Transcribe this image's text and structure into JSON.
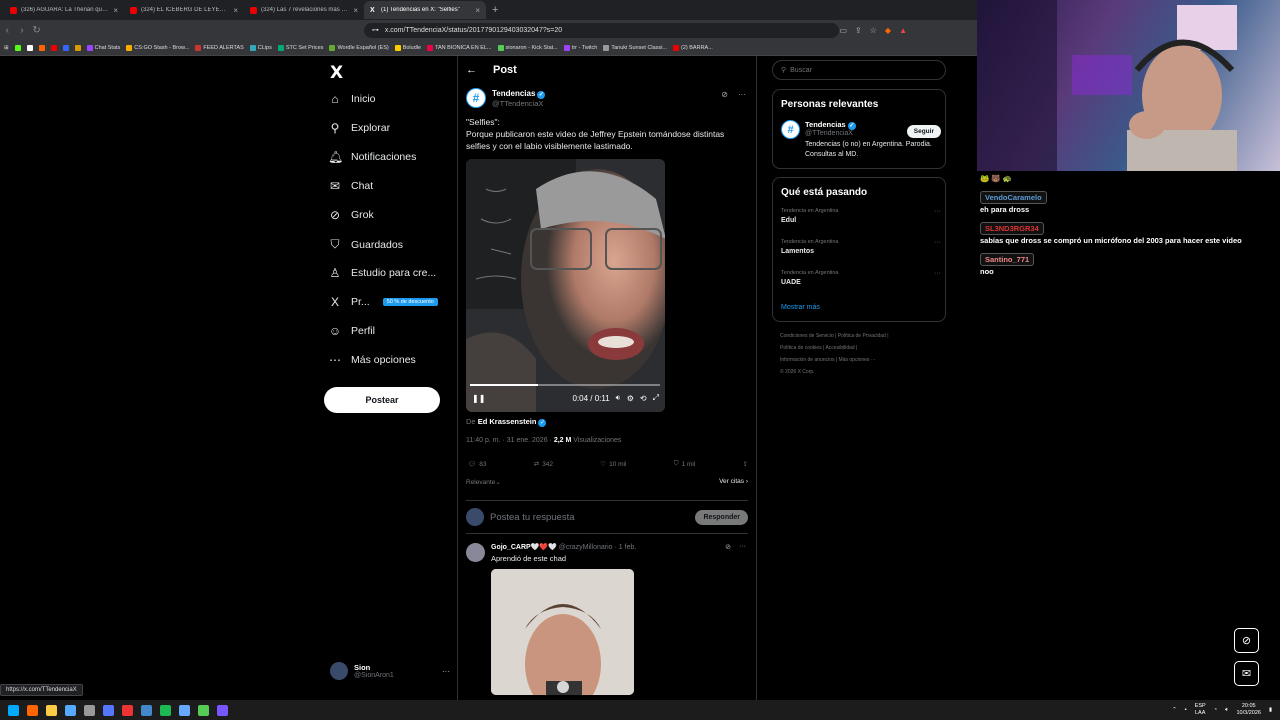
{
  "browser": {
    "tabs": [
      {
        "title": "(326) AGUARA: La Therian que Resulto",
        "icon": "youtube-icon"
      },
      {
        "title": "(324) EL ICEBERG DE LEYENDAS URBANAS",
        "icon": "youtube-icon"
      },
      {
        "title": "(324) Las 7 revelaciones más perturbadoras",
        "icon": "youtube-icon"
      },
      {
        "title": "(1) Tendencias en X: \"Selfies\"",
        "icon": "x-icon",
        "active": true
      }
    ],
    "url": "x.com/TTendenciaX/status/2017790129403032047?s=20",
    "bookmarks": [
      "Chat Stats",
      "CS:GO Stash - Brow...",
      "FEED ALERTAS",
      "CLips",
      "STC Set Prices",
      "Wordle Español (ES)",
      "Boludle",
      "TAN BIONICA EN EL...",
      "sionaron - Kick Stat...",
      "trr - Twitch",
      "Tanuki Sunset Classi...",
      "(2) BARRA..."
    ],
    "status_url": "https://x.com/TTendenciaX"
  },
  "nav": {
    "logo": "X",
    "items": [
      {
        "label": "Inicio",
        "icon": "home-icon"
      },
      {
        "label": "Explorar",
        "icon": "search-icon"
      },
      {
        "label": "Notificaciones",
        "icon": "bell-icon"
      },
      {
        "label": "Chat",
        "icon": "mail-icon"
      },
      {
        "label": "Grok",
        "icon": "grok-icon"
      },
      {
        "label": "Guardados",
        "icon": "bookmark-icon"
      },
      {
        "label": "Estudio para cre...",
        "icon": "creator-icon"
      },
      {
        "label": "Pr...",
        "icon": "premium-icon",
        "promo": "50 % de descuento"
      },
      {
        "label": "Perfil",
        "icon": "person-icon"
      },
      {
        "label": "Más opciones",
        "icon": "more-icon"
      }
    ],
    "post_button": "Postear",
    "user": {
      "name": "Sion",
      "handle": "@SionAron1"
    }
  },
  "post": {
    "header": "Post",
    "author": {
      "name": "Tendencias",
      "handle": "@TTendenciaX"
    },
    "text_line1": "\"Selfies\":",
    "text_line2": "Porque publicaron este video de Jeffrey Epstein tomándose distintas selfies y con el labio visiblemente lastimado.",
    "video": {
      "time": "0:04 / 0:11",
      "progress": 0.36
    },
    "credit_prefix": "De",
    "credit_name": "Ed Krassenstein",
    "meta_time": "11:40 p. m. · 31 ene. 2026 ·",
    "meta_views": "2,2 M",
    "meta_views_label": "Visualizaciones",
    "stats": {
      "replies": "83",
      "reposts": "342",
      "likes": "10 mil",
      "bookmarks": "1 mil"
    },
    "sort_label": "Relevante",
    "quotes_label": "Ver citas",
    "reply_placeholder": "Postea tu respuesta",
    "reply_button": "Responder"
  },
  "reply": {
    "name": "Gojo_CARP🤍❤️🤍",
    "handle": "@crazyMillonario · 1 feb.",
    "text": "Aprendió de este chad"
  },
  "sidebar": {
    "search_placeholder": "Buscar",
    "relevant_title": "Personas relevantes",
    "relevant": {
      "name": "Tendencias",
      "handle": "@TTendenciaX",
      "bio": "Tendencias (o no) en Argentina. Parodia. Consultas al MD.",
      "follow": "Seguir"
    },
    "trends_title": "Qué está pasando",
    "trends": [
      {
        "context": "Tendencia en Argentina",
        "name": "Edul"
      },
      {
        "context": "Tendencia en Argentina",
        "name": "Lamentos"
      },
      {
        "context": "Tendencia en Argentina",
        "name": "UADE"
      }
    ],
    "show_more": "Mostrar más",
    "footer_line1": "Condiciones de Servicio | Política de Privacidad |",
    "footer_line2": "Política de cookies | Accesibilidad |",
    "footer_line3": "Información de anuncios | Más opciones ···",
    "footer_line4": "© 2026 X Corp."
  },
  "chat": [
    {
      "user": "VendoCaramelo",
      "color": "#5b9bd5",
      "text": "eh para dross"
    },
    {
      "user": "SL3ND3RGR34",
      "color": "#d33",
      "text": "sabías que dross se compró un micrófono del 2003 para hacer este video"
    },
    {
      "user": "Santino_771",
      "color": "#e88",
      "text": "noo"
    }
  ],
  "tray": {
    "lang": "ESP",
    "lang2": "LAA",
    "time": "20:05",
    "date": "10/3/2026"
  }
}
